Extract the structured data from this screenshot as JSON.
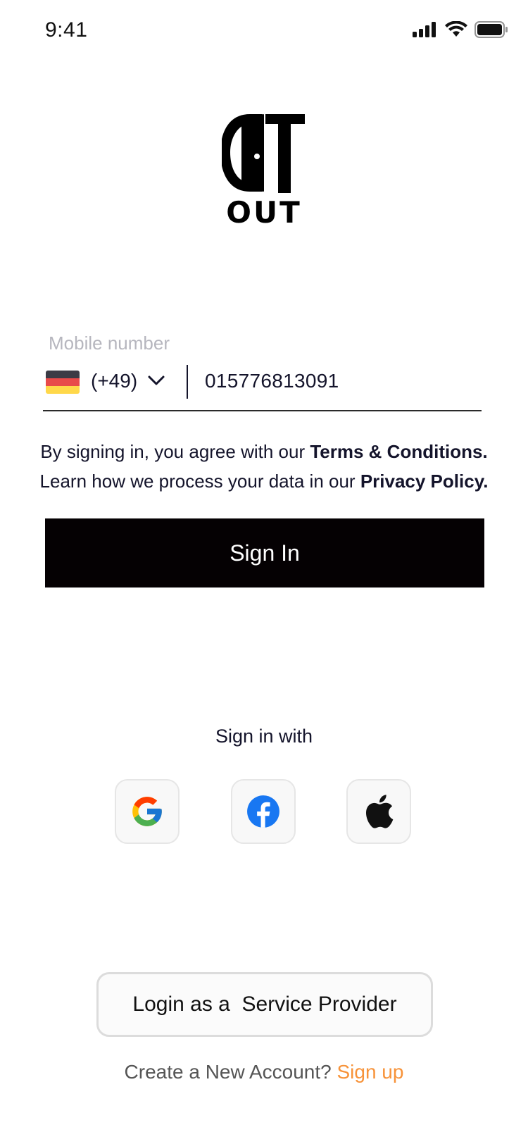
{
  "status_bar": {
    "time": "9:41"
  },
  "logo": {
    "text": "OUT"
  },
  "mobile": {
    "label": "Mobile number",
    "country_code": "(+49)",
    "number": "015776813091",
    "flag_colors": [
      "#3b3b45",
      "#e84a4a",
      "#ffd84a"
    ]
  },
  "legal": {
    "prefix1": "By signing in, you agree with our ",
    "terms": "Terms & Conditions.",
    "prefix2": "Learn how we process your data in our ",
    "privacy": "Privacy Policy."
  },
  "sign_in_button": "Sign In",
  "sign_in_with": "Sign in with",
  "social": [
    "google-icon",
    "facebook-icon",
    "apple-icon"
  ],
  "provider_button": "Login as a  Service Provider",
  "signup": {
    "prompt": "Create a New Account? ",
    "link": "Sign up"
  },
  "colors": {
    "primary_button": "#050103",
    "accent": "#f7933a",
    "text": "#14142b"
  }
}
